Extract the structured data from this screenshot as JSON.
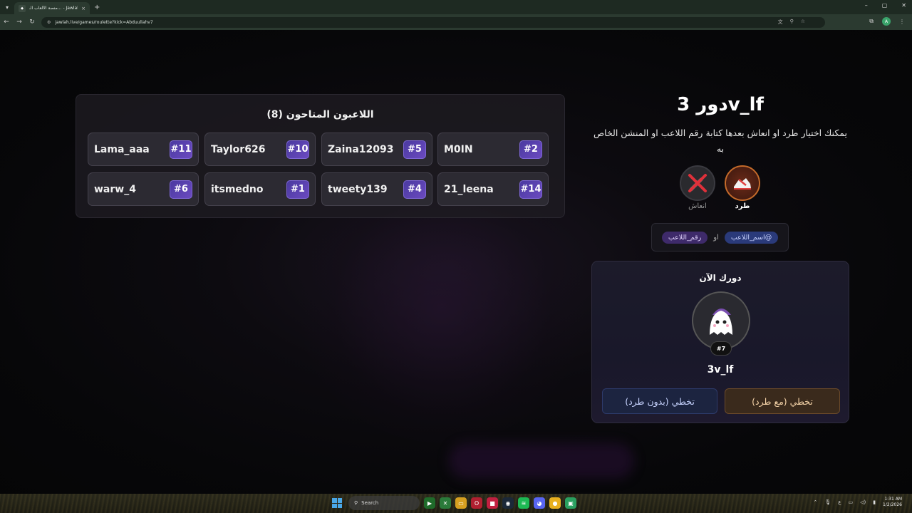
{
  "browser": {
    "tab_title": "منصة الألعاب الـ... - Jawlah | جولة",
    "url": "jawlah.live/games/roulette?kick=Abduullahv7",
    "tab_close": "×",
    "new_tab": "+"
  },
  "players_panel": {
    "title": "اللاعبون المتاحون (8)",
    "players": [
      {
        "name": "Lama_aaa",
        "num": "#11"
      },
      {
        "name": "Taylor626",
        "num": "#10"
      },
      {
        "name": "Zaina12093",
        "num": "#5"
      },
      {
        "name": "M0IN",
        "num": "#2"
      },
      {
        "name": "warw_4",
        "num": "#6"
      },
      {
        "name": "itsmedno",
        "num": "#1"
      },
      {
        "name": "tweety139",
        "num": "#4"
      },
      {
        "name": "21_leena",
        "num": "#14"
      }
    ]
  },
  "turn": {
    "title": "دور 3v_lf",
    "description": "يمكنك اختيار طرد او انعاش بعدها كتابة رقم اللاعب او المنشن الخاص به"
  },
  "actions": {
    "kick_label": "طرد",
    "revive_label": "انعاش"
  },
  "hint": {
    "mention_chip": "@اسم_اللاعب",
    "or_text": "او",
    "number_chip": "رقم_اللاعب"
  },
  "current": {
    "label": "دورك الآن",
    "badge": "#7",
    "name": "3v_lf",
    "skip_with_kick": "تخطي (مع طرد)",
    "skip_without_kick": "تخطي (بدون طرد)"
  },
  "taskbar": {
    "search_placeholder": "Search",
    "time": "1:31 AM",
    "date": "1/2/2026",
    "lang": "ع"
  },
  "colors": {
    "accent_purple": "#6b4ac0",
    "kick_orange": "#c46a2a",
    "page_bg": "#0d0b10"
  }
}
